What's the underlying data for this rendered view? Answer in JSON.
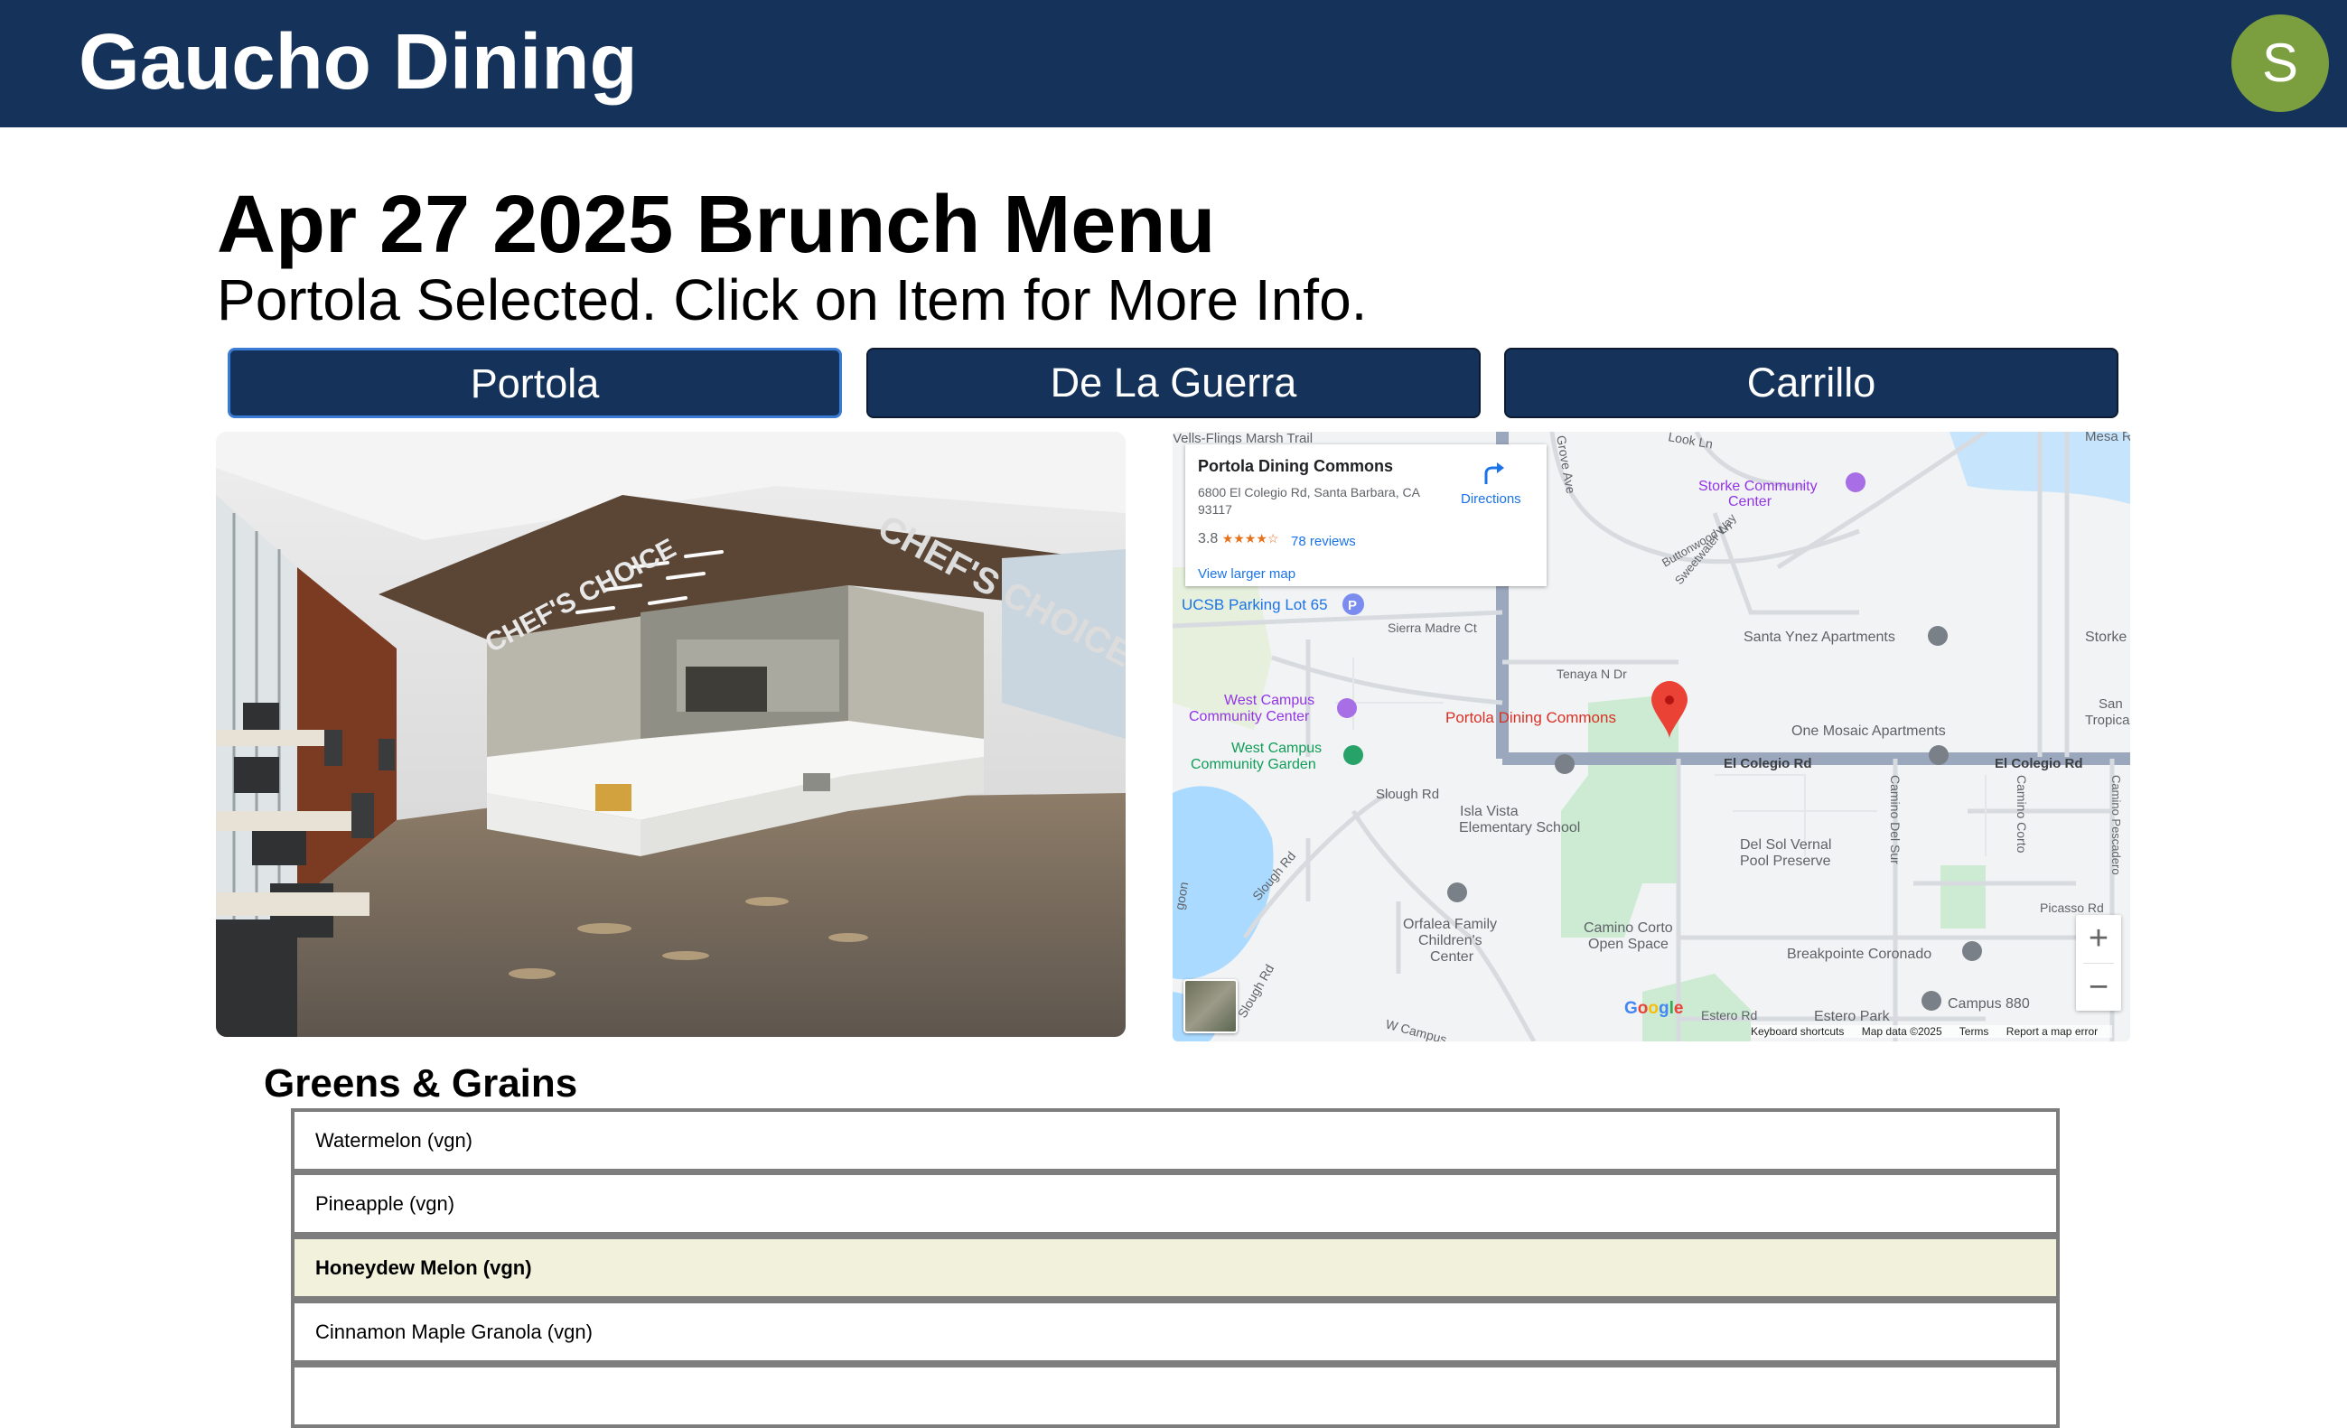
{
  "header": {
    "title": "Gaucho Dining",
    "avatar_initial": "S"
  },
  "page": {
    "title": "Apr 27 2025 Brunch Menu",
    "subtitle": "Portola Selected. Click on Item for More Info."
  },
  "tabs": [
    {
      "label": "Portola",
      "active": true
    },
    {
      "label": "De La Guerra",
      "active": false
    },
    {
      "label": "Carrillo",
      "active": false
    }
  ],
  "photo": {
    "signs": [
      "CHEF'S CHOICE",
      "CHEF'S CHOICE"
    ]
  },
  "map": {
    "card": {
      "name": "Portola Dining Commons",
      "address": "6800 El Colegio Rd, Santa Barbara, CA 93117",
      "rating": "3.8",
      "stars": "★★★★☆",
      "reviews": "78 reviews",
      "larger_map": "View larger map",
      "directions": "Directions"
    },
    "labels": {
      "marsh_trail": "Vells-Flings Marsh Trail",
      "grove": "Grove Ave",
      "look_ln": "Look Ln",
      "mesa": "Mesa R",
      "storke_cc": [
        "Storke Community",
        "Center"
      ],
      "buttonwood": "Buttonwood Ln",
      "sweetwater": "Sweetwater Way",
      "parking": "UCSB Parking Lot 65",
      "sierra_madre": "Sierra Madre Ct",
      "tenaya": "Tenaya N Dr",
      "santa_ynez": "Santa Ynez Apartments",
      "storke": "Storke",
      "west_campus_cc": [
        "West Campus",
        "Community Center"
      ],
      "portola_pin": "Portola Dining Commons",
      "san": "San",
      "tropicana": "Tropicana",
      "one_mosaic": "One Mosaic Apartments",
      "west_campus_garden": [
        "West Campus",
        "Community Garden"
      ],
      "el_colegio_1": "El Colegio Rd",
      "el_colegio_2": "El Colegio Rd",
      "slough_rd": "Slough Rd",
      "isla_vista": [
        "Isla Vista",
        "Elementary School"
      ],
      "camino_corto": "Camino Corto",
      "camino_del_sur": "Camino Del Sur",
      "camino_pescadero": "Camino Pescadero",
      "del_sol": [
        "Del Sol Vernal",
        "Pool Preserve"
      ],
      "slough_rd_2": "Slough Rd",
      "lagoon": "goon",
      "orfalea": [
        "Orfalea Family",
        "Children's",
        "Center"
      ],
      "camino_corto_open": [
        "Camino Corto",
        "Open Space"
      ],
      "picasso": "Picasso Rd",
      "breakpointe": "Breakpointe Coronado",
      "slough_rd_3": "Slough Rd",
      "w_campus": "W Campus",
      "estero_rd": "Estero Rd",
      "estero_park": "Estero Park",
      "campus_880": "Campus 880"
    },
    "zoom_in": "+",
    "zoom_out": "−",
    "google": [
      "G",
      "o",
      "o",
      "g",
      "l",
      "e"
    ],
    "footer": [
      "Keyboard shortcuts",
      "Map data ©2025",
      "Terms",
      "Report a map error"
    ]
  },
  "menu": {
    "section": "Greens & Grains",
    "items": [
      {
        "name": "Watermelon (vgn)",
        "highlighted": false
      },
      {
        "name": "Pineapple (vgn)",
        "highlighted": false
      },
      {
        "name": "Honeydew Melon (vgn)",
        "highlighted": true
      },
      {
        "name": "Cinnamon Maple Granola (vgn)",
        "highlighted": false
      },
      {
        "name": "",
        "highlighted": false
      }
    ]
  },
  "colors": {
    "header_bg": "#14325a",
    "avatar_bg": "#7b9e3e",
    "highlight_row": "#f1f1dc"
  }
}
